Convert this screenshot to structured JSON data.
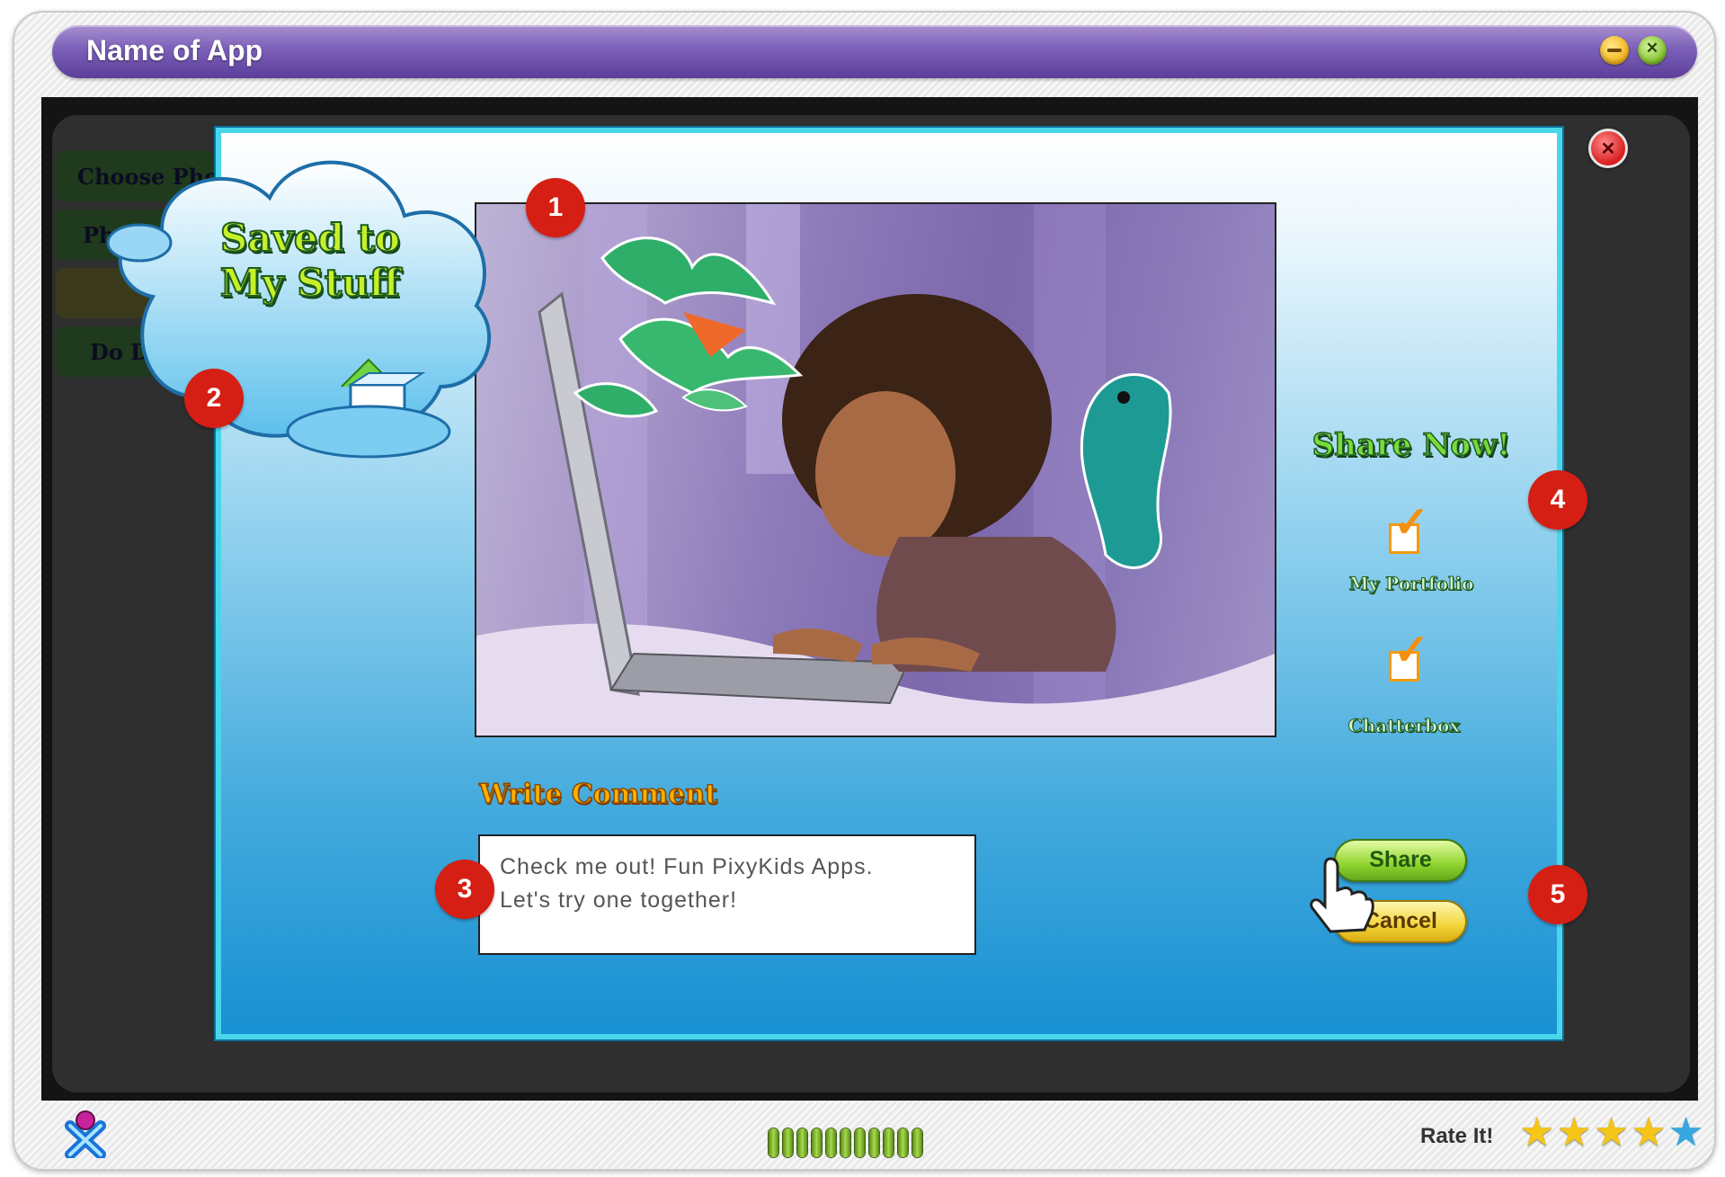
{
  "window": {
    "title": "Name of App"
  },
  "side_menu": {
    "items": [
      "Choose Pho",
      "Ph",
      "",
      "Do Doo"
    ]
  },
  "saved_badge": {
    "text": "Saved to My Stuff"
  },
  "comment": {
    "heading": "Write Comment",
    "text": "Check me out! Fun PixyKids Apps.\nLet's try one together!"
  },
  "share": {
    "heading": "Share Now!",
    "options": [
      {
        "label": "My Portfolio",
        "checked": true
      },
      {
        "label": "Chatterbox",
        "checked": true
      }
    ],
    "share_button": "Share",
    "cancel_button": "Cancel"
  },
  "callouts": [
    "1",
    "2",
    "3",
    "4",
    "5"
  ],
  "footer": {
    "rate_label": "Rate It!",
    "rating": {
      "filled": 4,
      "total": 5
    },
    "progress_segments": 11
  },
  "icons": [
    "minimize-icon",
    "close-icon",
    "modal-close-icon",
    "cloud-icon",
    "gift-box-icon",
    "checkmark-icon",
    "pointer-hand-icon",
    "pixykids-logo-icon",
    "star-icon",
    "loading-indicator-icon"
  ],
  "colors": {
    "title_bar": "#7b5fb8",
    "modal_border": "#49d6ea",
    "accent_green": "#8fd42d",
    "accent_orange": "#f39a12",
    "callout": "#d51f14"
  }
}
